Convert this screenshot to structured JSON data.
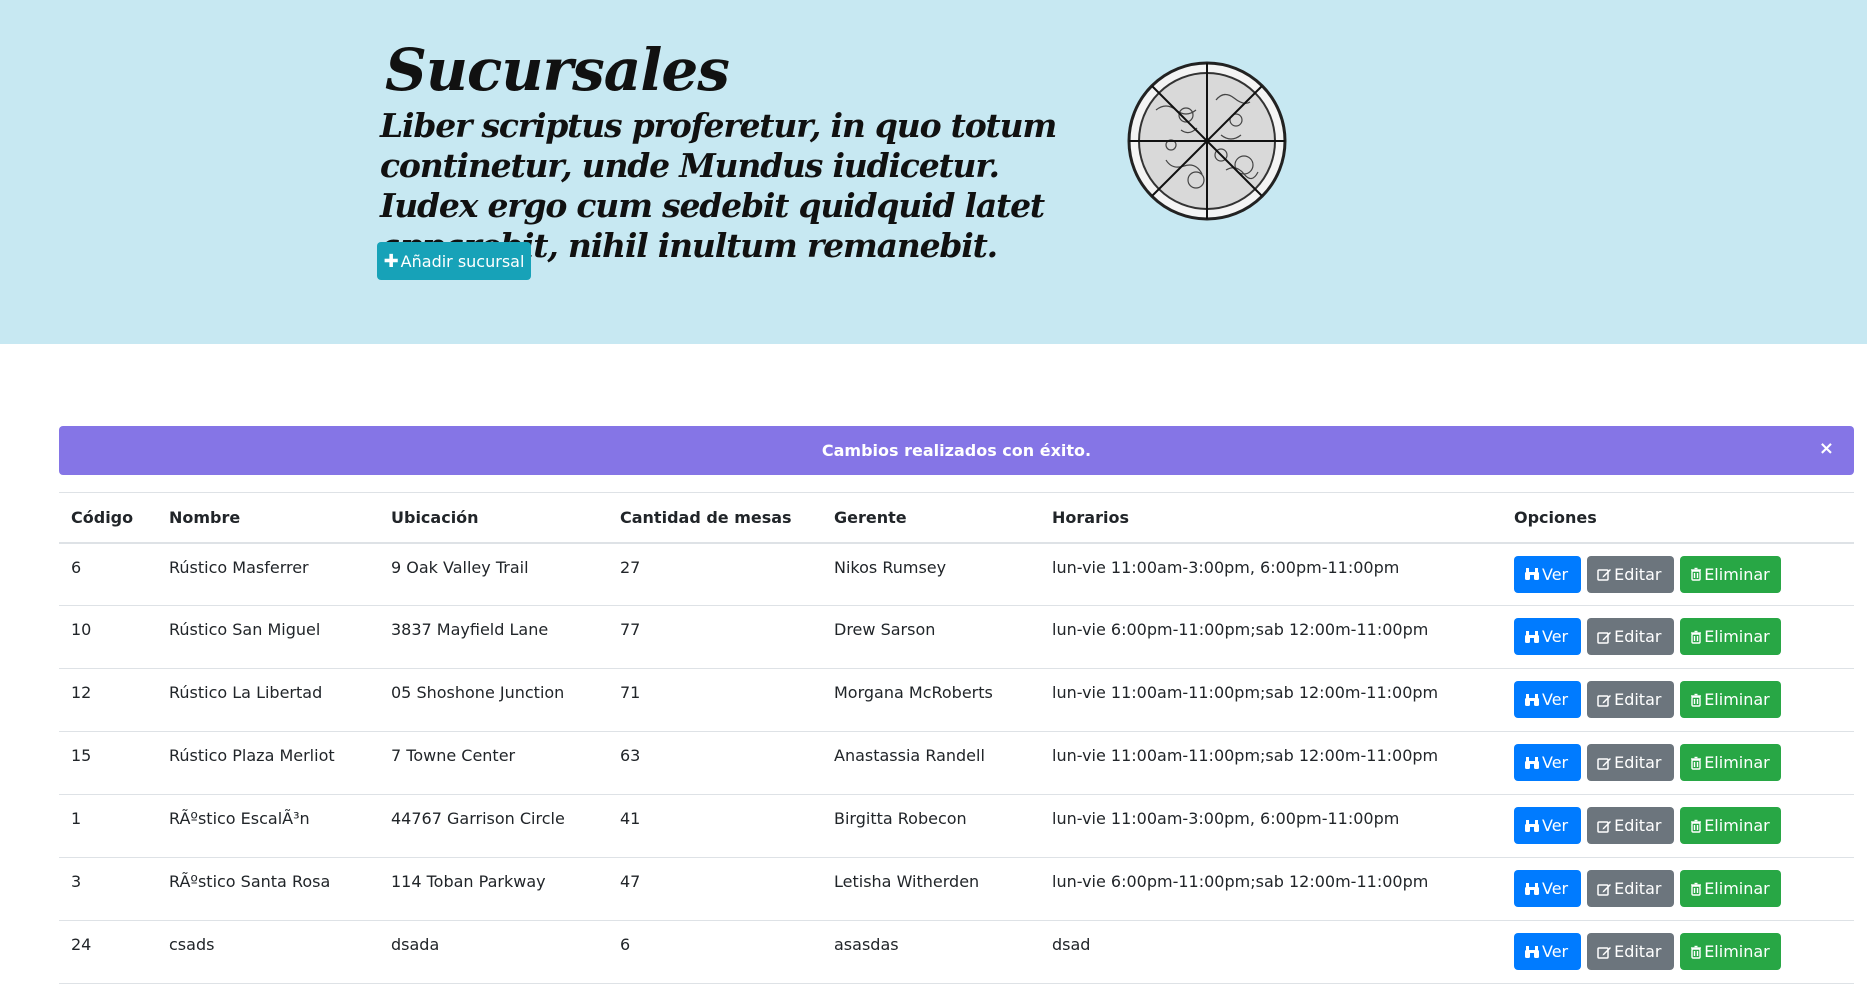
{
  "hero": {
    "title": "Sucursales",
    "subtitle": "Liber scriptus proferetur, in quo totum continetur, unde Mundus iudicetur. Iudex ergo cum sedebit quidquid latet apparebit, nihil inultum remanebit.",
    "add_button_label": "Añadir sucursal",
    "bg_color": "#c7e8f2"
  },
  "alert": {
    "message": "Cambios realizados con éxito.",
    "close_label": "×",
    "color": "#8575e6"
  },
  "table": {
    "headers": {
      "code": "Código",
      "name": "Nombre",
      "location": "Ubicación",
      "tables": "Cantidad de mesas",
      "manager": "Gerente",
      "hours": "Horarios",
      "options": "Opciones"
    },
    "actions": {
      "view": "Ver",
      "edit": "Editar",
      "delete": "Eliminar"
    },
    "rows": [
      {
        "code": "6",
        "name": "Rústico Masferrer",
        "location": "9 Oak Valley Trail",
        "tables": "27",
        "manager": "Nikos Rumsey",
        "hours": "lun-vie 11:00am-3:00pm, 6:00pm-11:00pm"
      },
      {
        "code": "10",
        "name": "Rústico San Miguel",
        "location": "3837 Mayfield Lane",
        "tables": "77",
        "manager": "Drew Sarson",
        "hours": "lun-vie 6:00pm-11:00pm;sab 12:00m-11:00pm"
      },
      {
        "code": "12",
        "name": "Rústico La Libertad",
        "location": "05 Shoshone Junction",
        "tables": "71",
        "manager": "Morgana McRoberts",
        "hours": "lun-vie 11:00am-11:00pm;sab 12:00m-11:00pm"
      },
      {
        "code": "15",
        "name": "Rústico Plaza Merliot",
        "location": "7 Towne Center",
        "tables": "63",
        "manager": "Anastassia Randell",
        "hours": "lun-vie 11:00am-11:00pm;sab 12:00m-11:00pm"
      },
      {
        "code": "1",
        "name": "RÃºstico EscalÃ³n",
        "location": "44767 Garrison Circle",
        "tables": "41",
        "manager": "Birgitta Robecon",
        "hours": "lun-vie 11:00am-3:00pm, 6:00pm-11:00pm"
      },
      {
        "code": "3",
        "name": "RÃºstico Santa Rosa",
        "location": "114 Toban Parkway",
        "tables": "47",
        "manager": "Letisha Witherden",
        "hours": "lun-vie 6:00pm-11:00pm;sab 12:00m-11:00pm"
      },
      {
        "code": "24",
        "name": "csads",
        "location": "dsada",
        "tables": "6",
        "manager": "asasdas",
        "hours": "dsad"
      }
    ]
  }
}
